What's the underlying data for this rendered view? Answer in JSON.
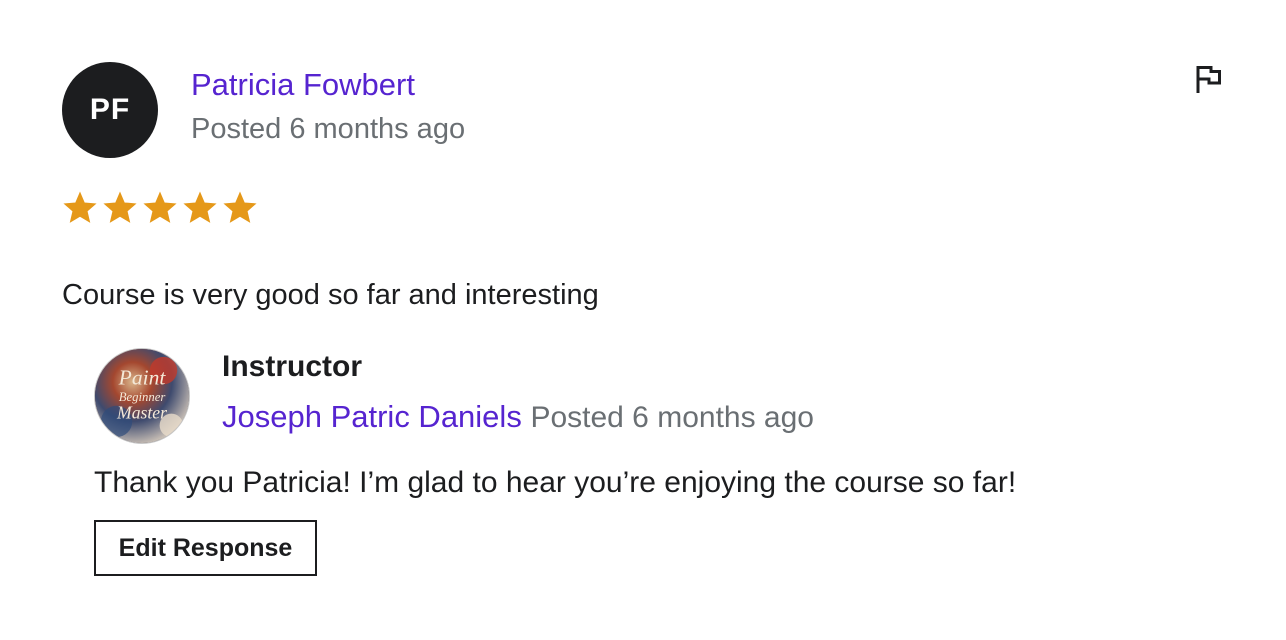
{
  "review": {
    "initials": "PF",
    "reviewer_name": "Patricia Fowbert",
    "posted": "Posted 6 months ago",
    "rating": 5,
    "rating_max": 5,
    "star_color": "#e59819",
    "text": "Course is very good so far and interesting",
    "flag_icon": "flag-icon"
  },
  "response": {
    "avatar_text": [
      "Paint",
      "Beginner",
      "Master"
    ],
    "role": "Instructor",
    "instructor_name": "Joseph Patric Daniels",
    "posted": "Posted 6 months ago",
    "text": "Thank you Patricia! I’m glad to hear you’re enjoying the course so far!",
    "edit_label": "Edit Response"
  },
  "colors": {
    "link": "#5624d0",
    "muted": "#6a6f73",
    "text": "#1c1d1f"
  }
}
